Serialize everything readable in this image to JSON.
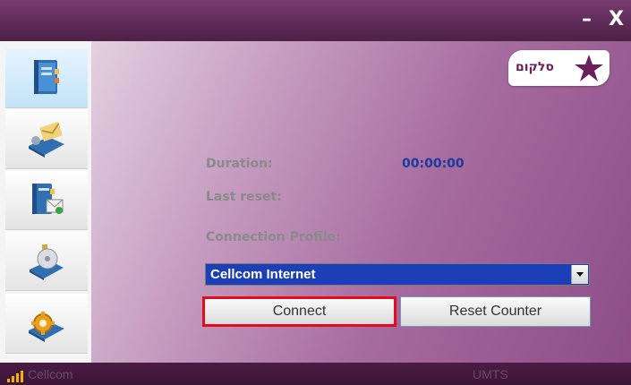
{
  "window": {
    "minimize_glyph": "–",
    "close_glyph": "X"
  },
  "sidebar": {
    "items": [
      {
        "name": "connection",
        "icon": "address-book-icon",
        "active": true
      },
      {
        "name": "sms",
        "icon": "envelope-book-icon",
        "active": false
      },
      {
        "name": "phonebook",
        "icon": "contacts-book-icon",
        "active": false
      },
      {
        "name": "tools",
        "icon": "disc-book-icon",
        "active": false
      },
      {
        "name": "settings",
        "icon": "gear-book-icon",
        "active": false
      }
    ]
  },
  "logo": {
    "text": "סלקום",
    "colors": {
      "brand": "#6a1f5c"
    }
  },
  "connection": {
    "duration_label": "Duration:",
    "duration_value": "00:00:00",
    "last_reset_label": "Last reset:",
    "profile_label": "Connection Profile:",
    "profile_value": "Cellcom Internet"
  },
  "buttons": {
    "connect": "Connect",
    "reset_counter": "Reset Counter"
  },
  "status": {
    "carrier": "Cellcom",
    "network": "UMTS",
    "signal_bars": 4
  },
  "colors": {
    "titlebar": "#5c2a55",
    "accent_select": "#1c3fb8",
    "highlight_border": "#e00d1e",
    "value_text": "#1a3a9c"
  }
}
